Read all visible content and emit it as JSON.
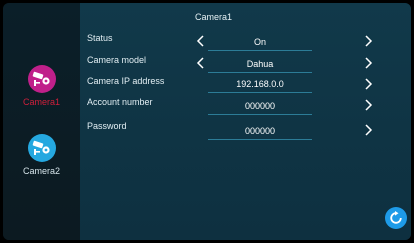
{
  "sidebar": {
    "items": [
      {
        "label": "Camera1",
        "icon": "cctv-camera-gear-icon",
        "color": "#c0208a",
        "active": true
      },
      {
        "label": "Camera2",
        "icon": "cctv-camera-gear-icon",
        "color": "#25a8e0",
        "active": false
      }
    ]
  },
  "header": {
    "title": "Camera1"
  },
  "settings": {
    "rows": [
      {
        "label": "Status",
        "value": "On"
      },
      {
        "label": "Camera model",
        "value": "Dahua"
      },
      {
        "label": "Camera IP address",
        "value": "192.168.0.0"
      },
      {
        "label": "Account number",
        "value": "000000"
      },
      {
        "label": "Password",
        "value": "000000"
      }
    ]
  },
  "colors": {
    "accent_active": "#d01f3c",
    "refresh_button": "#1e9be8",
    "underline": "#2c7c97"
  },
  "actions": {
    "refresh_icon": "refresh-icon"
  }
}
